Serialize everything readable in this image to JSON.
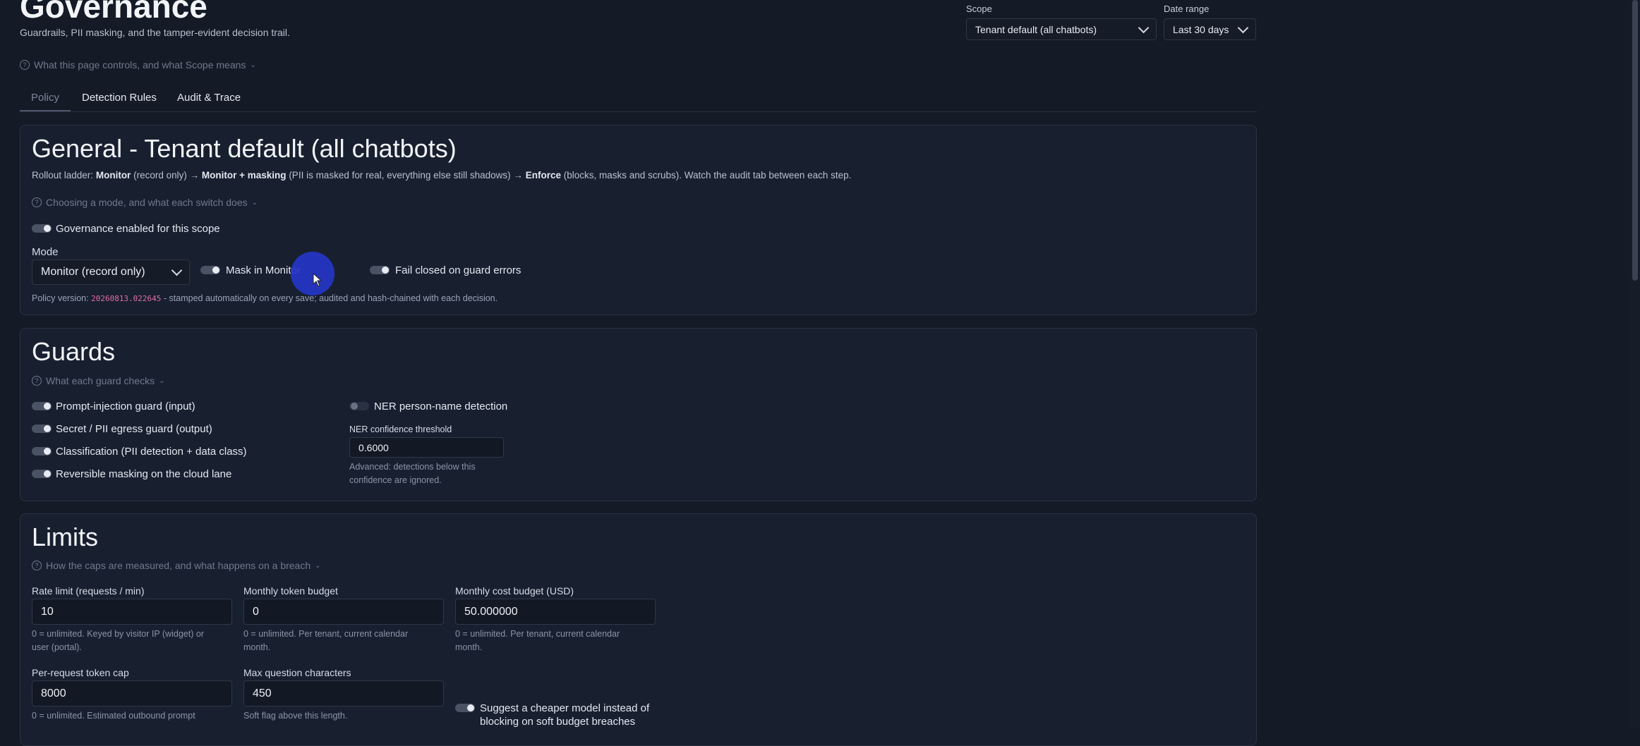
{
  "header": {
    "title": "Governance",
    "subtitle": "Guardrails, PII masking, and the tamper-evident decision trail.",
    "help": "What this page controls, and what Scope means"
  },
  "filters": {
    "scope_label": "Scope",
    "scope_value": "Tenant default (all chatbots)",
    "date_label": "Date range",
    "date_value": "Last 30 days"
  },
  "tabs": [
    "Policy",
    "Detection Rules",
    "Audit & Trace"
  ],
  "general": {
    "title": "General - Tenant default (all chatbots)",
    "ladder_prefix": "Rollout ladder:",
    "ladder_monitor": "Monitor",
    "ladder_monitor_note": "(record only) →",
    "ladder_mask": "Monitor + masking",
    "ladder_mask_note": "(PII is masked for real, everything else still shadows) →",
    "ladder_enforce": "Enforce",
    "ladder_enforce_note": "(blocks, masks and scrubs). Watch the audit tab between each step.",
    "help": "Choosing a mode, and what each switch does",
    "enabled_label": "Governance enabled for this scope",
    "mode_label": "Mode",
    "mode_value": "Monitor (record only)",
    "mask_label": "Mask in Monitor",
    "fail_closed_label": "Fail closed on guard errors",
    "policy_prefix": "Policy version:",
    "policy_version": "20260813.022645",
    "policy_suffix": "- stamped automatically on every save; audited and hash-chained with each decision."
  },
  "guards": {
    "title": "Guards",
    "help": "What each guard checks",
    "items": [
      "Prompt-injection guard (input)",
      "Secret / PII egress guard (output)",
      "Classification (PII detection + data class)",
      "Reversible masking on the cloud lane"
    ],
    "ner_label": "NER person-name detection",
    "ner_threshold_label": "NER confidence threshold",
    "ner_threshold_value": "0.6000",
    "ner_hint_1": "Advanced: detections below this",
    "ner_hint_2": "confidence are ignored."
  },
  "limits": {
    "title": "Limits",
    "help": "How the caps are measured, and what happens on a breach",
    "rate_label": "Rate limit (requests / min)",
    "rate_value": "10",
    "rate_hint_1": "0 = unlimited. Keyed by visitor IP (widget) or",
    "rate_hint_2": "user (portal).",
    "token_label": "Monthly token budget",
    "token_value": "0",
    "token_hint_1": "0 = unlimited. Per tenant, current calendar",
    "token_hint_2": "month.",
    "cost_label": "Monthly cost budget (USD)",
    "cost_value": "50.000000",
    "cost_hint_1": "0 = unlimited. Per tenant, current calendar",
    "cost_hint_2": "month.",
    "cap_label": "Per-request token cap",
    "cap_value": "8000",
    "cap_hint": "0 = unlimited. Estimated outbound prompt",
    "maxq_label": "Max question characters",
    "maxq_value": "450",
    "maxq_hint": "Soft flag above this length.",
    "suggest_1": "Suggest a cheaper model instead of",
    "suggest_2": "blocking on soft budget breaches"
  },
  "colors": {
    "background": "#141a26",
    "card": "#182030",
    "accent_code": "#e06c9f",
    "cursor": "#2636c7"
  }
}
